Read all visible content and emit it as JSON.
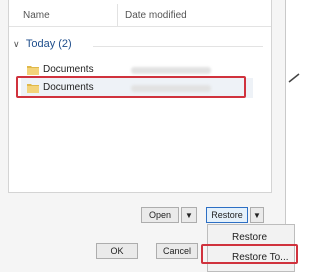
{
  "columns": {
    "name": "Name",
    "date": "Date modified"
  },
  "group": {
    "label": "Today (2)",
    "expanded": true
  },
  "rows": [
    {
      "name": "Documents",
      "selected": false
    },
    {
      "name": "Documents",
      "selected": true
    }
  ],
  "buttons": {
    "open": "Open",
    "restore": "Restore",
    "ok": "OK",
    "cancel": "Cancel"
  },
  "restore_menu": {
    "items": [
      "Restore",
      "Restore To..."
    ],
    "highlighted_index": 1
  },
  "colors": {
    "highlight_box": "#d0323d",
    "group_text": "#1f4e8c",
    "restore_button_border": "#2d6fc4",
    "folder_icon": "#e0b94a"
  },
  "icons": {
    "folder": "folder-icon",
    "group_toggle": "chevron-down-icon",
    "dropdown": "caret-down-icon"
  }
}
